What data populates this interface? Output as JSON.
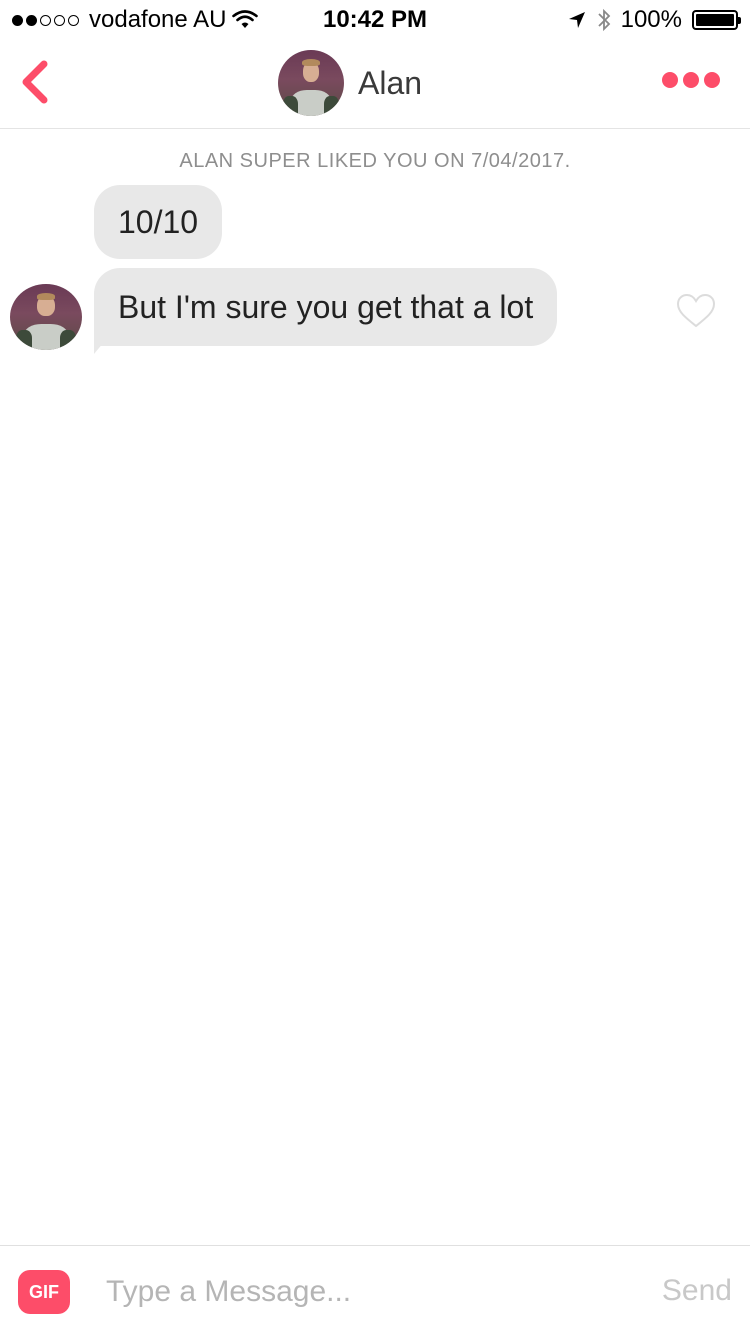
{
  "status_bar": {
    "signal_filled": 2,
    "signal_total": 5,
    "carrier": "vodafone AU",
    "time": "10:42 PM",
    "battery_text": "100%",
    "battery_level": 1.0,
    "icons": [
      "wifi-icon",
      "location-icon",
      "bluetooth-icon",
      "battery-icon"
    ]
  },
  "header": {
    "back_icon": "chevron-left-icon",
    "contact_name": "Alan",
    "more_icon": "more-dots-icon"
  },
  "conversation": {
    "superlike_note": "ALAN SUPER LIKED YOU ON 7/04/2017.",
    "messages": [
      {
        "text": "10/10"
      },
      {
        "text": "But I'm sure you get that a lot"
      }
    ]
  },
  "composer": {
    "gif_label": "GIF",
    "placeholder": "Type a Message...",
    "value": "",
    "send_label": "Send"
  },
  "colors": {
    "accent": "#fd4d69",
    "bubble": "#e8e8e8",
    "muted_text": "#8e8e8e",
    "send_disabled": "#c8c8c8"
  }
}
